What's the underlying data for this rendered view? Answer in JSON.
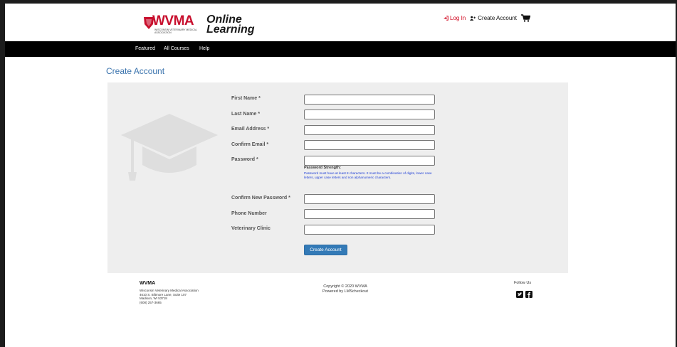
{
  "header": {
    "logo": {
      "brand": "WVMA",
      "subtitle": "WISCONSIN VETERINARY MEDICAL ASSOCIATION",
      "product_line1": "Online",
      "product_line2": "Learning"
    },
    "login_label": "Log In",
    "create_account_label": "Create Account",
    "icons": {
      "login": "sign-in-icon",
      "create_account": "user-plus-icon",
      "cart": "cart-icon"
    },
    "colors": {
      "login": "#d0021b"
    }
  },
  "nav": {
    "items": [
      "Featured",
      "All Courses",
      "Help"
    ],
    "background": "#000000"
  },
  "page": {
    "title": "Create Account"
  },
  "form": {
    "fields": [
      {
        "label": "First Name *",
        "value": ""
      },
      {
        "label": "Last Name *",
        "value": ""
      },
      {
        "label": "Email Address *",
        "value": ""
      },
      {
        "label": "Confirm Email *",
        "value": ""
      },
      {
        "label": "Password *",
        "value": ""
      },
      {
        "label": "Confirm New Password *",
        "value": ""
      },
      {
        "label": "Phone Number",
        "value": ""
      },
      {
        "label": "Veterinary Clinic",
        "value": ""
      }
    ],
    "password_strength_label": "Password Strength:",
    "password_help": "Password must have at least 8 characters. It must be a combination of digits, lower case letters, upper case letters and non alphanumeric characters.",
    "submit_label": "Create Account",
    "submit_color": "#337ab7",
    "panel_color": "#eeeeee"
  },
  "footer": {
    "org": "WVMA",
    "address_lines": [
      "Wisconsin Veterinary Medical Association",
      "4610 S. Biltmore Lane, Suite 107",
      "Madison, WI 53718",
      "(608) 257-3665"
    ],
    "copyright": "Copyright © 2020 WVMA",
    "powered_by": "Powered by LMScheckout",
    "follow_label": "Follow Us",
    "social_icons": [
      "twitter-icon",
      "facebook-icon"
    ]
  }
}
